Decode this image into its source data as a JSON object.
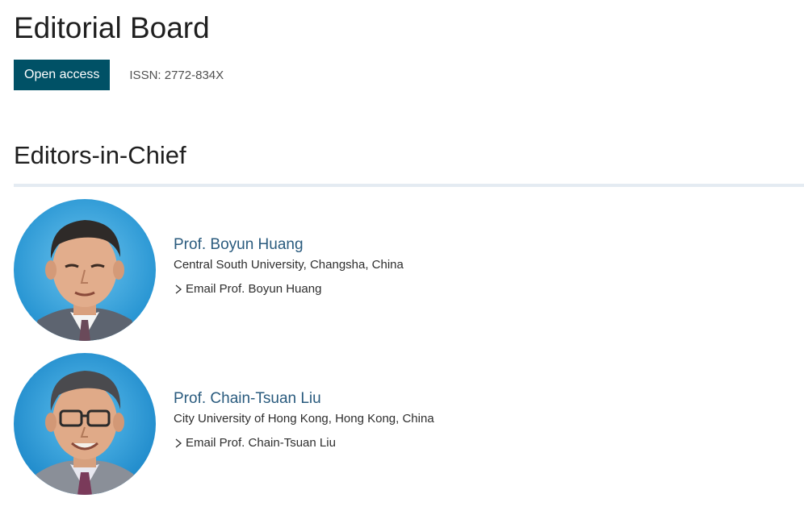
{
  "page": {
    "title": "Editorial Board",
    "open_access_label": "Open access",
    "issn": "ISSN: 2772-834X"
  },
  "section": {
    "title": "Editors-in-Chief"
  },
  "editors": [
    {
      "name": "Prof. Boyun Huang",
      "affiliation": "Central South University, Changsha, China",
      "email_label": "Email Prof. Boyun Huang"
    },
    {
      "name": "Prof. Chain-Tsuan Liu",
      "affiliation": "City University of Hong Kong, Hong Kong, China",
      "email_label": "Email Prof. Chain-Tsuan Liu"
    }
  ],
  "icons": {
    "email_link_icon": "chevron-right-icon"
  },
  "colors": {
    "open_access_bg": "#005166",
    "link": "#2a5b7e",
    "divider": "#e4ebf2",
    "portrait_background": "#2f9fd8"
  }
}
